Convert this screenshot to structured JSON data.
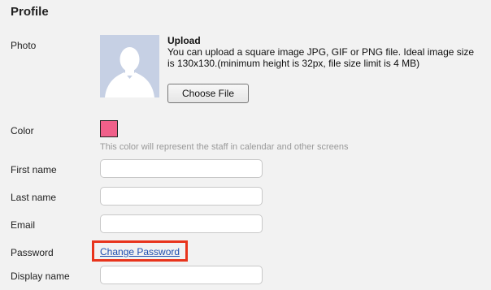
{
  "page": {
    "title": "Profile"
  },
  "photo": {
    "label": "Photo",
    "upload_title": "Upload",
    "upload_description": "You can upload a square image JPG, GIF or PNG file. Ideal image size is 130x130.(minimum height is 32px, file size limit is 4 MB)",
    "choose_button": "Choose File",
    "icon": "avatar-placeholder-icon"
  },
  "color": {
    "label": "Color",
    "value": "#f0608a",
    "hint": "This color will represent the staff in calendar and other screens"
  },
  "fields": {
    "first_name": {
      "label": "First name",
      "value": ""
    },
    "last_name": {
      "label": "Last name",
      "value": ""
    },
    "email": {
      "label": "Email",
      "value": ""
    },
    "display_name": {
      "label": "Display name",
      "value": ""
    }
  },
  "password": {
    "label": "Password",
    "link": "Change Password",
    "highlight_color": "#e8341c"
  }
}
